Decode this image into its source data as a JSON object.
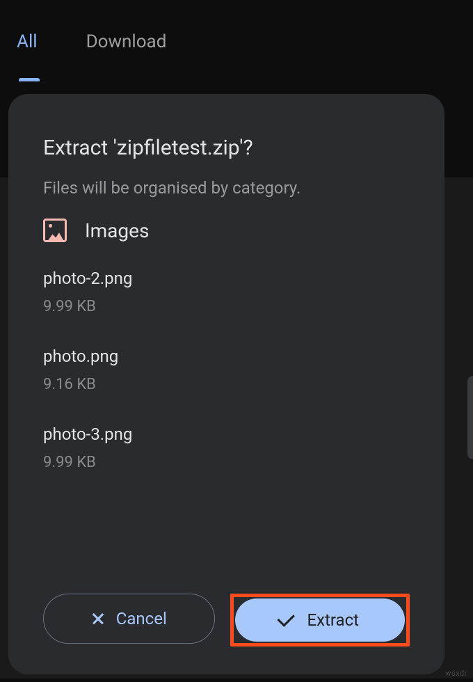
{
  "tabs": {
    "all": "All",
    "download": "Download"
  },
  "dialog": {
    "title": "Extract 'zipfiletest.zip'?",
    "subtitle": "Files will be organised by category.",
    "category_label": "Images",
    "files": [
      {
        "name": "photo-2.png",
        "size": "9.99 KB"
      },
      {
        "name": "photo.png",
        "size": "9.16 KB"
      },
      {
        "name": "photo-3.png",
        "size": "9.99 KB"
      }
    ],
    "cancel_label": "Cancel",
    "extract_label": "Extract"
  },
  "watermark": "wsxdr"
}
